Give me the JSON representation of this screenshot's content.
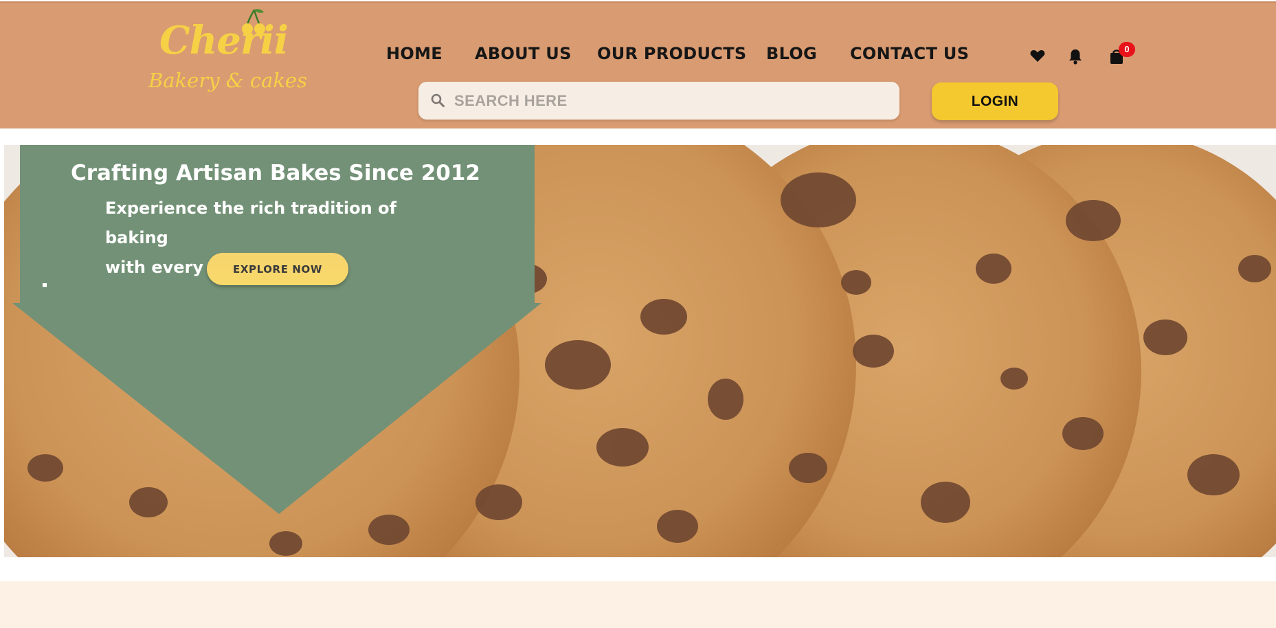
{
  "brand": {
    "name": "Cherii",
    "tagline": "Bakery & cakes",
    "colors": {
      "header_bg": "#d99b71",
      "accent_yellow": "#f4c82f",
      "hero_panel": "#739176",
      "badge_red": "#e8121b",
      "page_band": "#fdf1e5"
    }
  },
  "nav": {
    "items": [
      "HOME",
      "ABOUT US",
      "OUR PRODUCTS",
      "BLOG",
      "CONTACT US"
    ]
  },
  "header_icons": {
    "wishlist": "heart-icon",
    "notifications": "bell-icon",
    "cart": "shopping-bag-icon",
    "cart_count": "0"
  },
  "search": {
    "icon": "search-icon",
    "placeholder": "SEARCH HERE",
    "value": ""
  },
  "auth": {
    "login_label": "LOGIN"
  },
  "hero": {
    "title": "Crafting Artisan Bakes Since 2012",
    "subtitle_line1": "Experience the rich tradition of baking",
    "subtitle_line2": "with every bite.",
    "cta_label": "EXPLORE NOW"
  }
}
